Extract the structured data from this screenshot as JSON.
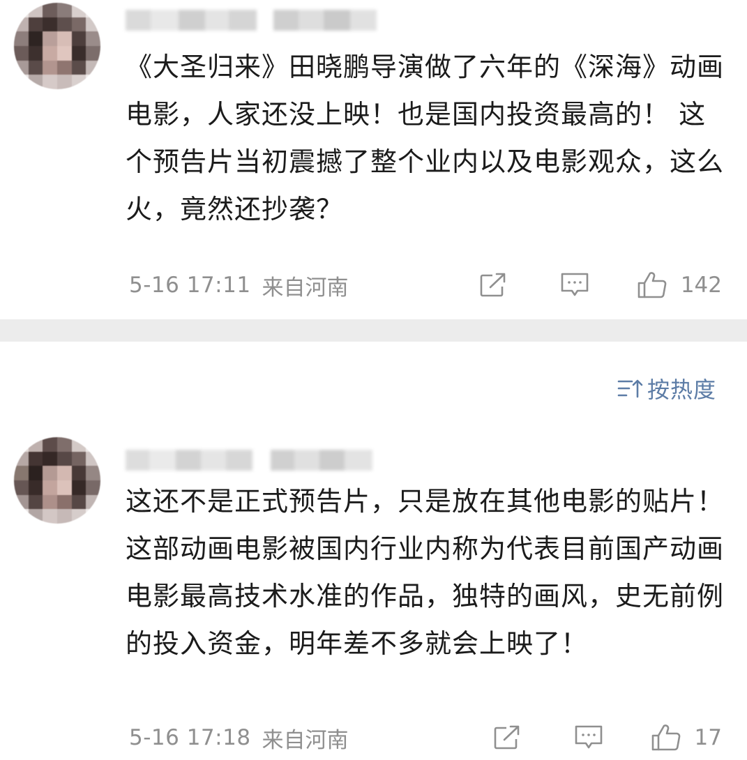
{
  "comments": [
    {
      "text": "《大圣归来》田晓鹏导演做了六年的《深海》动画电影，人家还没上映！也是国内投资最高的！ 这个预告片当初震撼了整个业内以及电影观众，这么火，竟然还抄袭？",
      "time": "5-16 17:11",
      "location": "来自河南",
      "likes": "142",
      "share_icon": "share-icon",
      "reply_icon": "comment-icon",
      "like_icon": "thumbs-up-icon"
    },
    {
      "text": "这还不是正式预告片，只是放在其他电影的贴片！这部动画电影被国内行业内称为代表目前国产动画电影最高技术水准的作品，独特的画风，史无前例的投入资金，明年差不多就会上映了！",
      "time": "5-16 17:18",
      "location": "来自河南",
      "likes": "17",
      "share_icon": "share-icon",
      "reply_icon": "comment-icon",
      "like_icon": "thumbs-up-icon"
    }
  ],
  "sort": {
    "label": "按热度",
    "icon": "sort-icon"
  },
  "colors": {
    "meta_gray": "#8f8f8f",
    "link_blue": "#5c7ca6",
    "divider": "#ececec",
    "text": "#1b1b1b"
  }
}
